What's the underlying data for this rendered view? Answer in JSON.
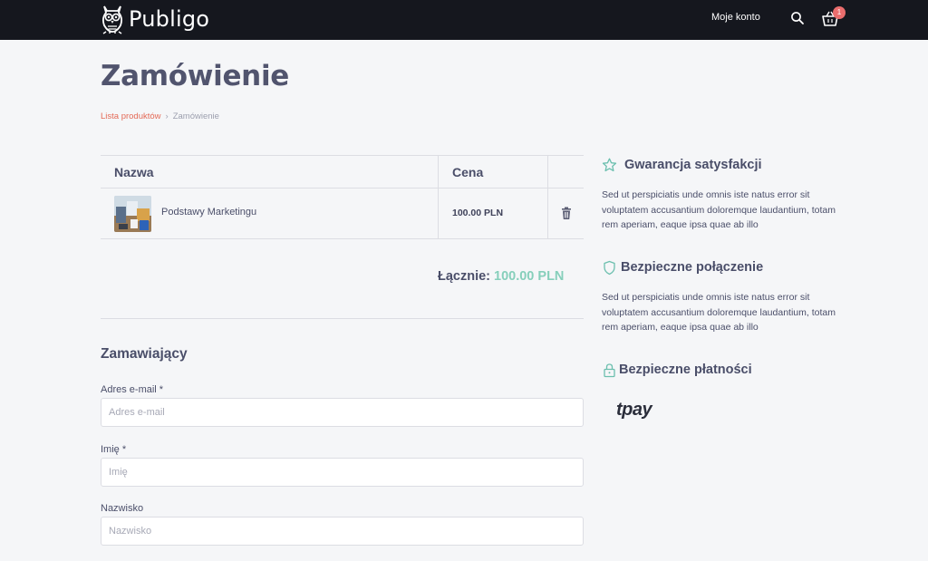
{
  "header": {
    "brand": "Publigo",
    "account_label": "Moje konto",
    "cart_count": "1"
  },
  "page": {
    "title": "Zamówienie",
    "breadcrumb": {
      "link": "Lista produktów",
      "separator": "›",
      "current": "Zamówienie"
    }
  },
  "cart": {
    "columns": [
      "Nazwa",
      "Cena"
    ],
    "items": [
      {
        "name": "Podstawy Marketingu",
        "price": "100.00 PLN"
      }
    ],
    "total_label": "Łącznie:",
    "total_amount": "100.00 PLN"
  },
  "form": {
    "section_title": "Zamawiający",
    "fields": [
      {
        "label": "Adres e-mail *",
        "placeholder": "Adres e-mail",
        "value": ""
      },
      {
        "label": "Imię *",
        "placeholder": "Imię",
        "value": ""
      },
      {
        "label": "Nazwisko",
        "placeholder": "Nazwisko",
        "value": ""
      }
    ]
  },
  "features": [
    {
      "icon": "star-badge-icon",
      "title": "Gwarancja satysfakcji",
      "text": "Sed ut perspiciatis unde omnis iste natus error sit voluptatem accusantium doloremque laudantium, totam rem aperiam, eaque ipsa quae ab illo"
    },
    {
      "icon": "shield-icon",
      "title": "Bezpieczne połączenie",
      "text": "Sed ut perspiciatis unde omnis iste natus error sit voluptatem accusantium doloremque laudantium, totam rem aperiam, eaque ipsa quae ab illo"
    },
    {
      "icon": "lock-icon",
      "title": "Bezpieczne płatności",
      "text": ""
    }
  ],
  "payment_logo": "tpay",
  "colors": {
    "header_bg": "#15171e",
    "accent_link": "#e46a57",
    "total_amount": "#86cfbb",
    "badge": "#ea6d6d",
    "icon_teal": "#6bbfae"
  }
}
